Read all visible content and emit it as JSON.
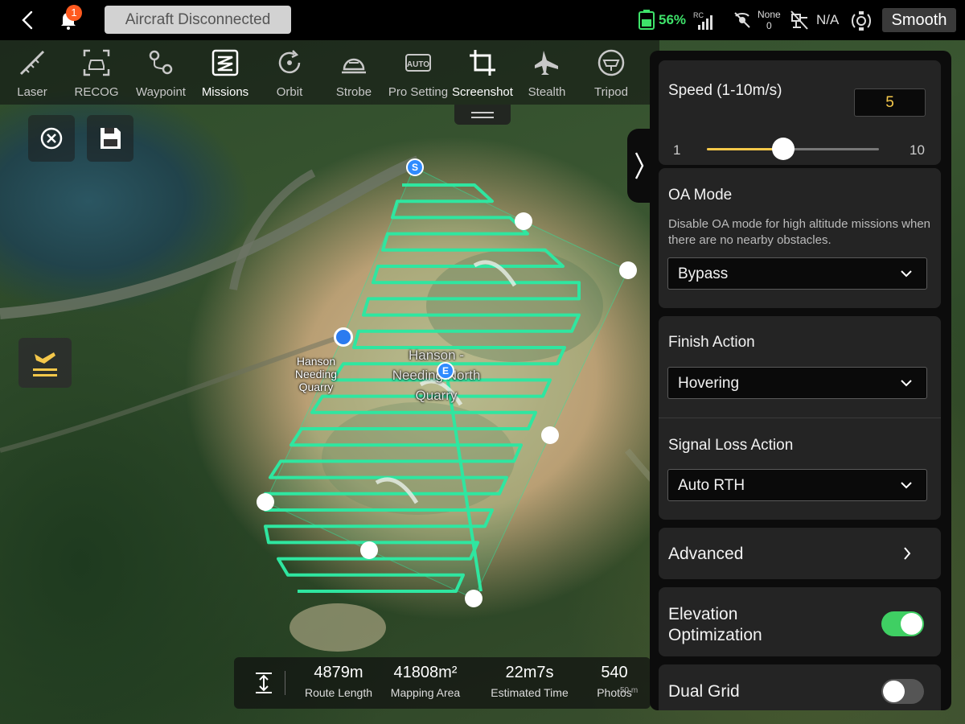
{
  "topbar": {
    "notification_count": "1",
    "connection_status": "Aircraft Disconnected",
    "battery_percent": "56%",
    "rc_label": "RC",
    "video_signal_label": "None",
    "video_signal_value": "0",
    "gps_status": "N/A",
    "flight_mode": "Smooth"
  },
  "toolbar": {
    "items": [
      {
        "label": "Laser",
        "icon": "laser-icon"
      },
      {
        "label": "RECOG",
        "icon": "recog-icon"
      },
      {
        "label": "Waypoint",
        "icon": "waypoint-icon"
      },
      {
        "label": "Missions",
        "icon": "missions-icon",
        "active": true
      },
      {
        "label": "Orbit",
        "icon": "orbit-icon"
      },
      {
        "label": "Strobe",
        "icon": "strobe-icon"
      },
      {
        "label": "Pro Setting",
        "icon": "pro-setting-icon",
        "icon_text": "AUTO"
      },
      {
        "label": "Screenshot",
        "icon": "screenshot-icon"
      },
      {
        "label": "Stealth",
        "icon": "stealth-icon"
      },
      {
        "label": "Tripod",
        "icon": "tripod-icon"
      }
    ]
  },
  "map": {
    "label_small": [
      "Hanson",
      "Needing",
      "Quarry"
    ],
    "label_large": [
      "Hanson -",
      "Needing North",
      "Quarry"
    ],
    "start_marker": "S",
    "end_marker": "E",
    "route_color": "#2fe6a0",
    "scale_text": "50 m"
  },
  "stats": {
    "route_length": {
      "value": "4879m",
      "label": "Route Length"
    },
    "mapping_area": {
      "value": "41808m²",
      "label": "Mapping Area"
    },
    "estimated_time": {
      "value": "22m7s",
      "label": "Estimated Time"
    },
    "photos": {
      "value": "540",
      "label": "Photos"
    }
  },
  "panel": {
    "speed": {
      "title": "Speed (1-10m/s)",
      "value": "5",
      "min": "1",
      "max": "10",
      "fraction": 0.444
    },
    "oa_mode": {
      "title": "OA Mode",
      "description": "Disable OA mode for high altitude missions when there are no nearby obstacles.",
      "selected": "Bypass"
    },
    "finish_action": {
      "title": "Finish Action",
      "selected": "Hovering"
    },
    "signal_loss_action": {
      "title": "Signal Loss Action",
      "selected": "Auto RTH"
    },
    "advanced": {
      "title": "Advanced"
    },
    "elevation_optimization": {
      "title_line1": "Elevation",
      "title_line2": "Optimization",
      "enabled": true
    },
    "dual_grid": {
      "title": "Dual Grid",
      "enabled": false
    },
    "accent_color": "#f5c84a",
    "toggle_on_color": "#3fcf63"
  }
}
